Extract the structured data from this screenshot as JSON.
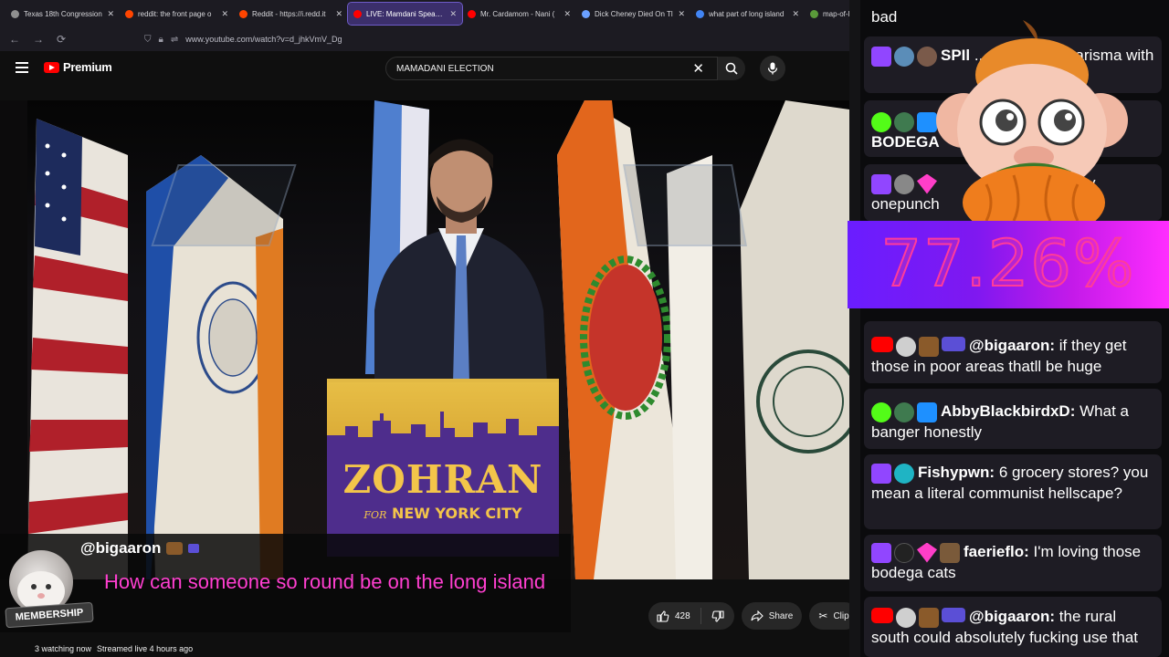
{
  "browser": {
    "tabs": [
      {
        "title": "Texas 18th Congression",
        "color": "#8f8f8f"
      },
      {
        "title": "reddit: the front page o",
        "color": "#ff4500"
      },
      {
        "title": "Reddit - https://i.redd.it",
        "color": "#ff4500"
      },
      {
        "title": "LIVE: Mamdani Speaks a",
        "color": "#ff0000",
        "active": true
      },
      {
        "title": "Mr. Cardamom - Nani (",
        "color": "#ff0000"
      },
      {
        "title": "Dick Cheney Died On Tl",
        "color": "#6aa0ff"
      },
      {
        "title": "what part of long island",
        "color": "#4285f4"
      },
      {
        "title": "map-of-long-isla",
        "color": "#5a9a3a"
      }
    ],
    "url": "www.youtube.com/watch?v=d_jhkVmV_Dg"
  },
  "youtube": {
    "brand": "Premium",
    "search_value": "MAMADANI ELECTION",
    "video": {
      "podium_title": "ZOHRAN",
      "podium_for": "FOR",
      "podium_city": "NEW YORK CITY"
    },
    "overlay": {
      "username": "@bigaaron",
      "badge": "MEMBERSHIP",
      "message": "How can someone so round be on the long island"
    },
    "actions": {
      "likes": "428",
      "share": "Share",
      "clip": "Clip"
    },
    "status": {
      "watching": "3 watching now",
      "streamed": "Streamed live 4 hours ago"
    }
  },
  "chat": {
    "messages": [
      {
        "text": "bad"
      },
      {
        "user": "SPIl",
        "text": "...ama-level charisma with"
      },
      {
        "user": "BODEGA",
        "text": ""
      },
      {
        "user": "",
        "text": "k why onepunch"
      },
      {
        "user": "@bigaaron",
        "text": "if they get those in poor areas thatll be huge"
      },
      {
        "user": "AbbyBlackbirdxD",
        "text": "What a banger honestly"
      },
      {
        "user": "Fishypwn",
        "text": "6 grocery stores? you mean a literal communist hellscape?"
      },
      {
        "user": "faerieflo",
        "text": "I'm loving those bodega cats"
      },
      {
        "user": "@bigaaron",
        "text": "the rural south could absolutely fucking use that"
      }
    ],
    "percent": "77.26%"
  }
}
